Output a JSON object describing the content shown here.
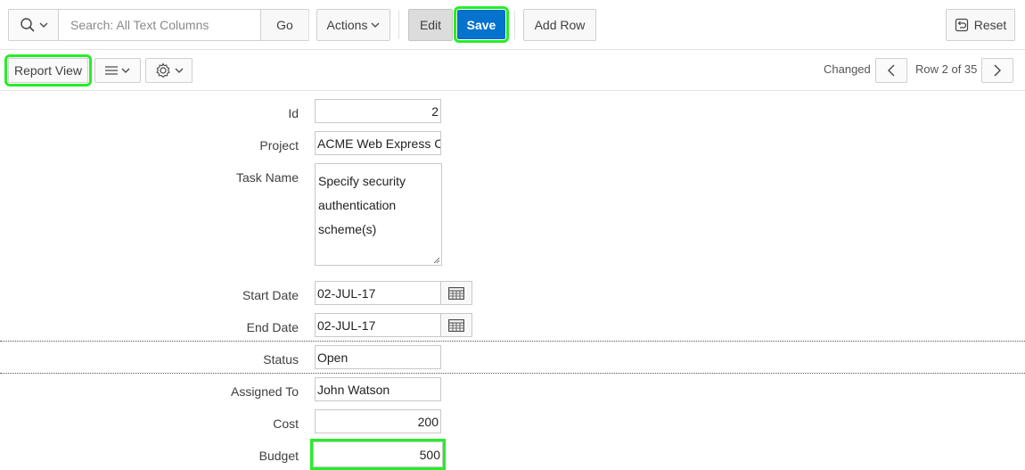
{
  "toolbar": {
    "search_placeholder": "Search: All Text Columns",
    "go_label": "Go",
    "actions_label": "Actions",
    "edit_label": "Edit",
    "save_label": "Save",
    "add_row_label": "Add Row",
    "reset_label": "Reset"
  },
  "subbar": {
    "report_view_label": "Report View",
    "changed_label": "Changed",
    "row_info": "Row 2 of 35"
  },
  "form": {
    "fields": {
      "id": {
        "label": "Id",
        "value": "2"
      },
      "project": {
        "label": "Project",
        "value": "ACME Web Express Configuration"
      },
      "task_name": {
        "label": "Task Name",
        "value": "Specify security authentication scheme(s)",
        "lines": [
          "Specify security",
          "authentication",
          "scheme(s)"
        ]
      },
      "start_date": {
        "label": "Start Date",
        "value": "02-JUL-17"
      },
      "end_date": {
        "label": "End Date",
        "value": "02-JUL-17"
      },
      "status": {
        "label": "Status",
        "value": "Open"
      },
      "assigned_to": {
        "label": "Assigned To",
        "value": "John Watson"
      },
      "cost": {
        "label": "Cost",
        "value": "200"
      },
      "budget": {
        "label": "Budget",
        "value": "500"
      }
    }
  },
  "colors": {
    "save_button": "#0572ce",
    "highlight": "#26ee26",
    "edit_button_active": "#dcdcdc"
  },
  "icons": [
    "search-icon",
    "chevron-down-icon",
    "reset-icon",
    "list-icon",
    "gear-icon",
    "chevron-left-icon",
    "chevron-right-icon",
    "calendar-icon"
  ]
}
